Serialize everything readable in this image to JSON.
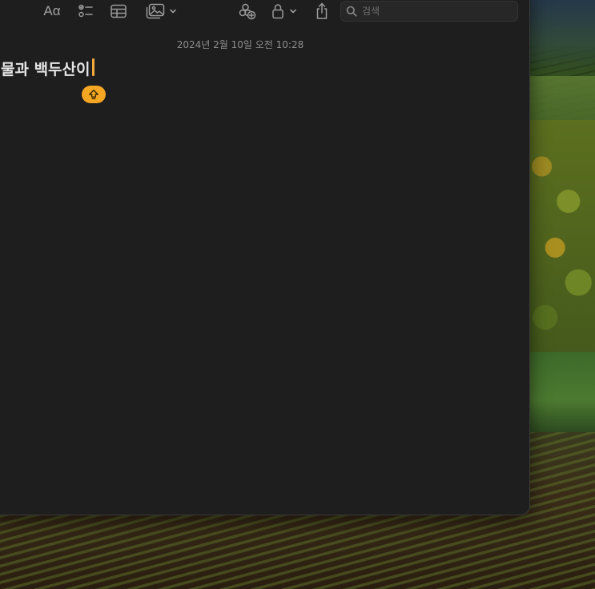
{
  "toolbar": {
    "format_label": "Aα",
    "search": {
      "placeholder": "검색"
    }
  },
  "note": {
    "date": "2024년 2월 10일 오전 10:28",
    "title": "물과 백두산이"
  },
  "icons": {
    "format": "text-format-icon",
    "checklist": "checklist-icon",
    "table": "table-icon",
    "media": "photo-media-icon",
    "collaborate": "collaborate-add-icon",
    "lock": "lock-icon",
    "share": "share-icon",
    "search": "magnifier-icon",
    "caps_lock": "caps-lock-icon"
  },
  "colors": {
    "window_bg": "#1e1e1e",
    "accent": "#f5a623",
    "text": "#e6e6e6",
    "muted": "#8e8e8e"
  }
}
